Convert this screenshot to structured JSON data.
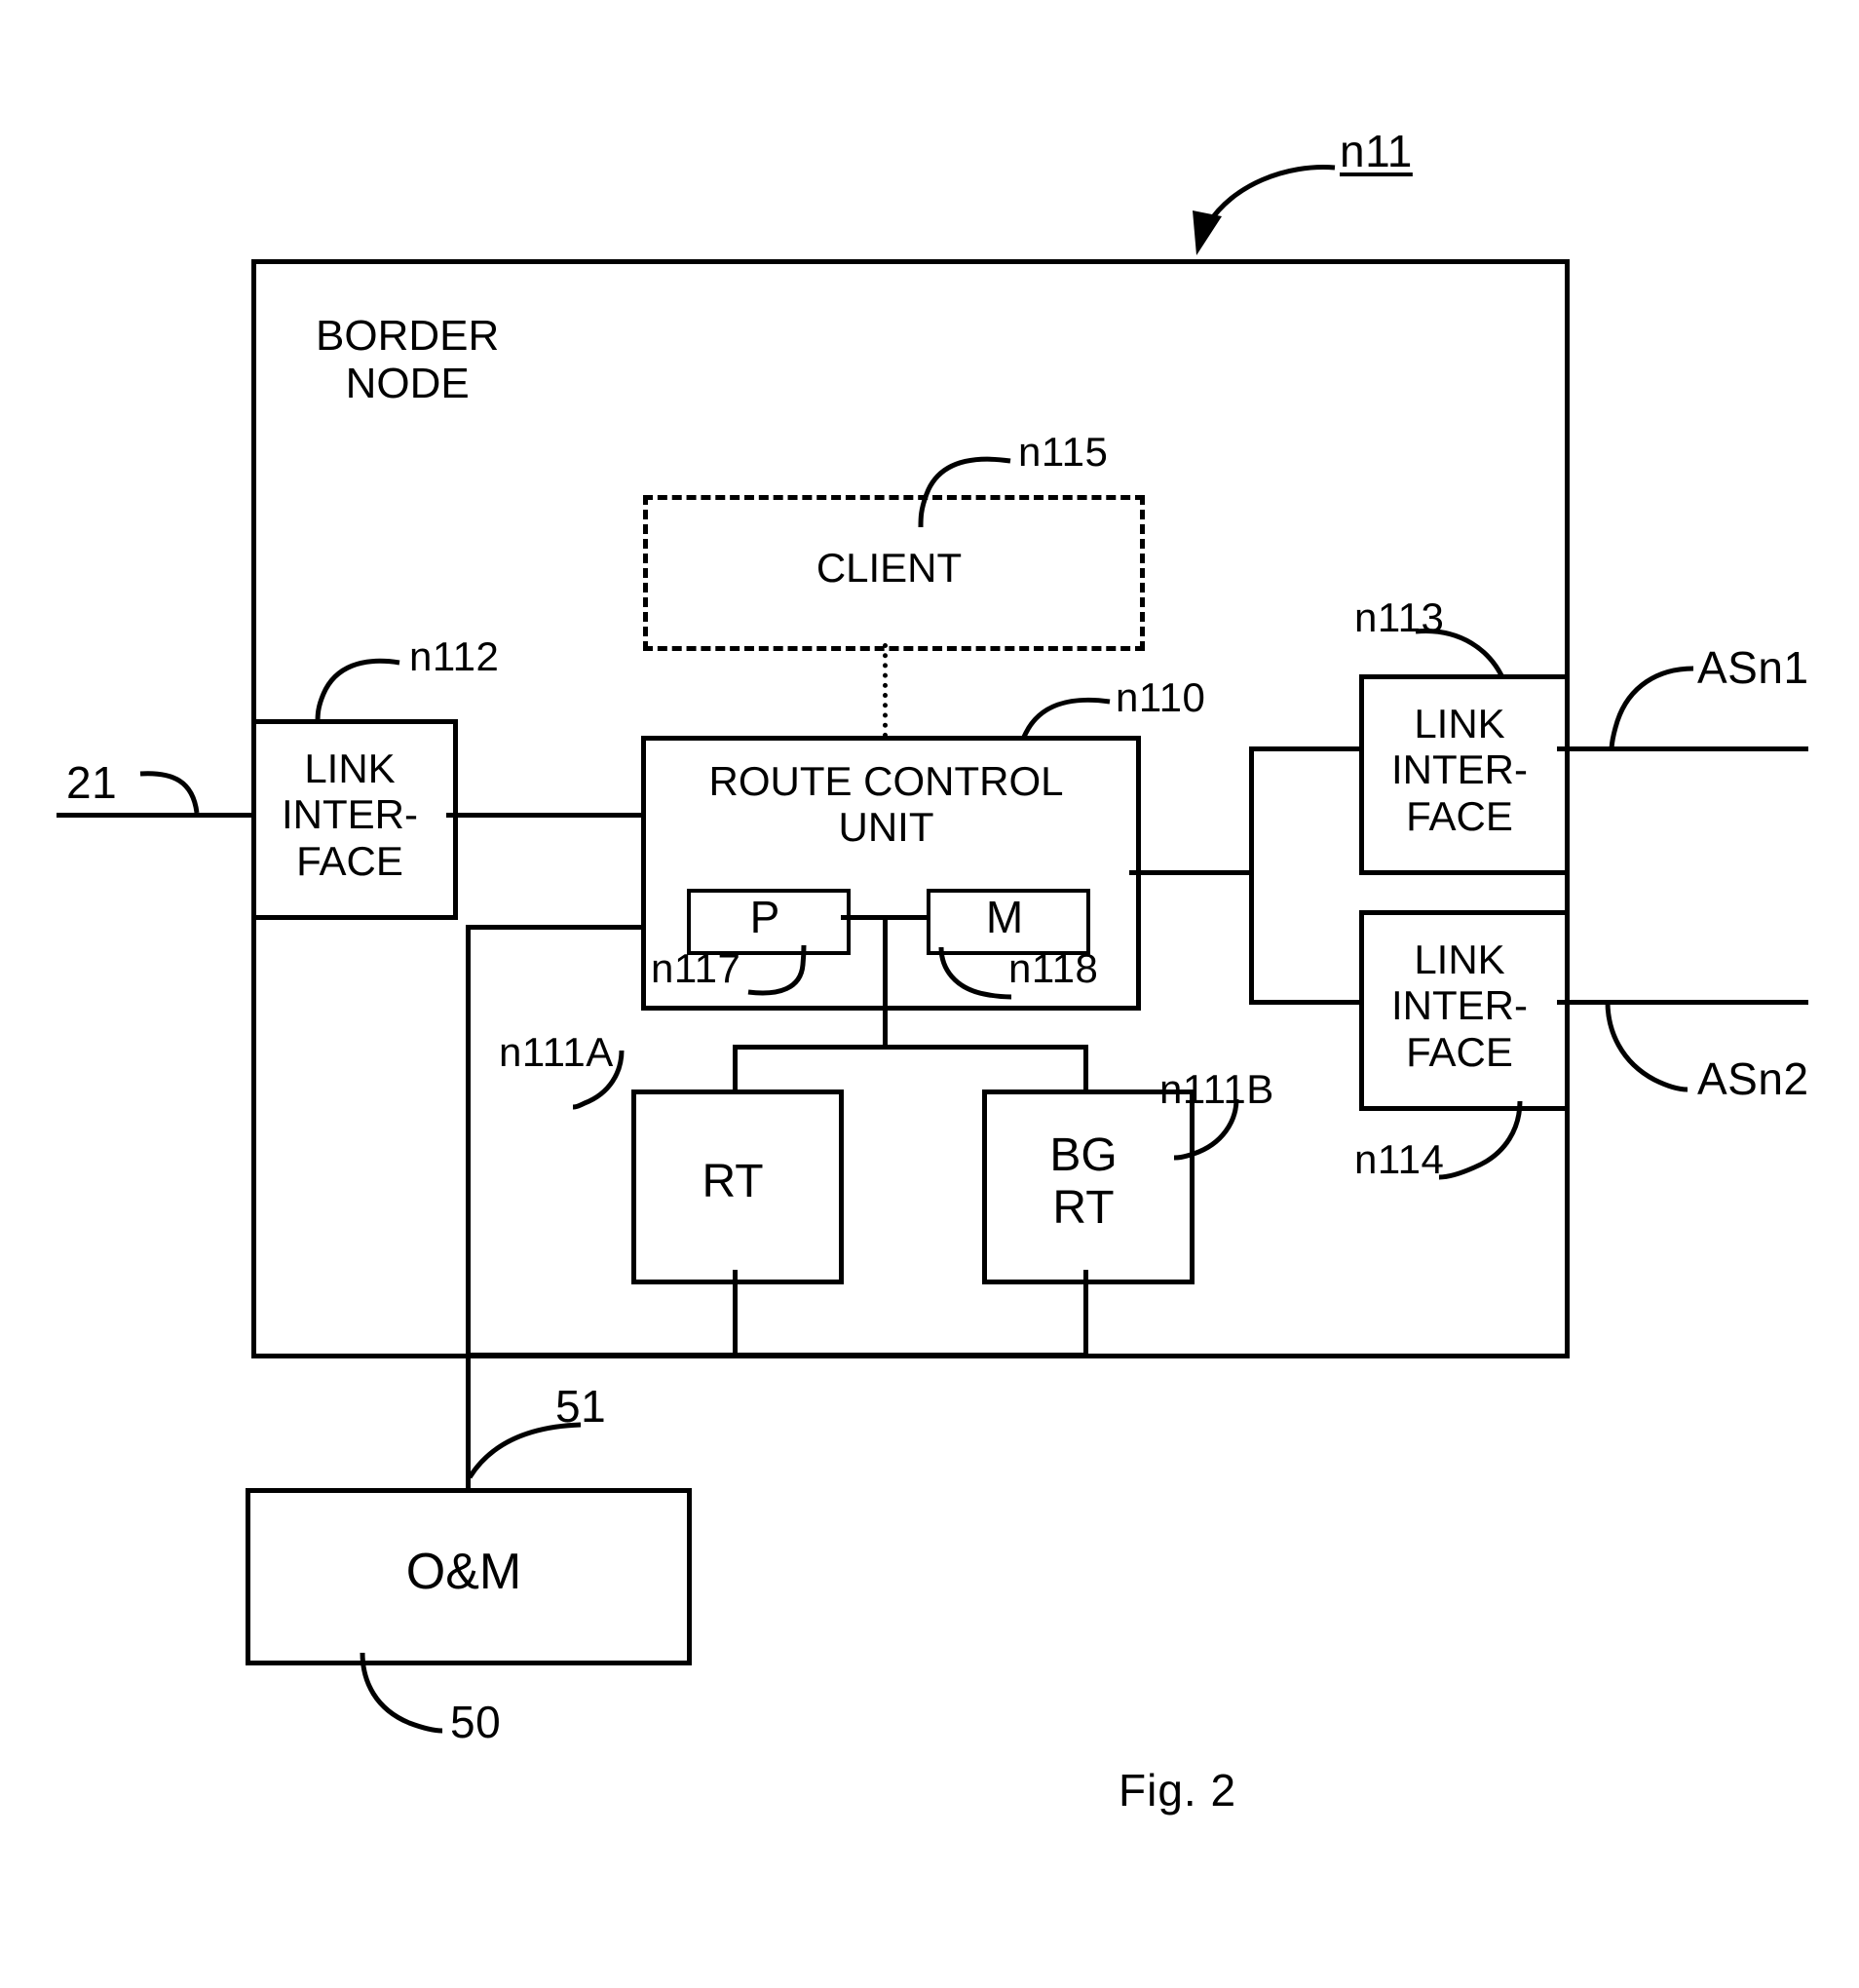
{
  "figure": {
    "caption": "Fig. 2",
    "top_reference": "n11"
  },
  "border_node": {
    "title": "BORDER\nNODE",
    "reference": "n11"
  },
  "blocks": {
    "client": {
      "label": "CLIENT",
      "reference": "n115",
      "style": "dashed"
    },
    "route_control_unit": {
      "label": "ROUTE CONTROL\nUNIT",
      "reference": "n110"
    },
    "p_unit": {
      "label": "P",
      "reference": "n117"
    },
    "m_unit": {
      "label": "M",
      "reference": "n118"
    },
    "rt": {
      "label": "RT",
      "reference": "n111A"
    },
    "bg_rt": {
      "label": "BG\nRT",
      "reference": "n111B"
    },
    "link_interface_left": {
      "label": "LINK\nINTER-\nFACE",
      "reference": "n112"
    },
    "link_interface_right_top": {
      "label": "LINK\nINTER-\nFACE",
      "reference": "n113"
    },
    "link_interface_right_bottom": {
      "label": "LINK\nINTER-\nFACE",
      "reference": "n114"
    },
    "oam": {
      "label": "O&M",
      "reference": "50"
    }
  },
  "links": {
    "left_link": "21",
    "asn1": "ASn1",
    "asn2": "ASn2",
    "oam_link": "51"
  },
  "colors": {
    "stroke": "#000000",
    "background": "#ffffff"
  }
}
